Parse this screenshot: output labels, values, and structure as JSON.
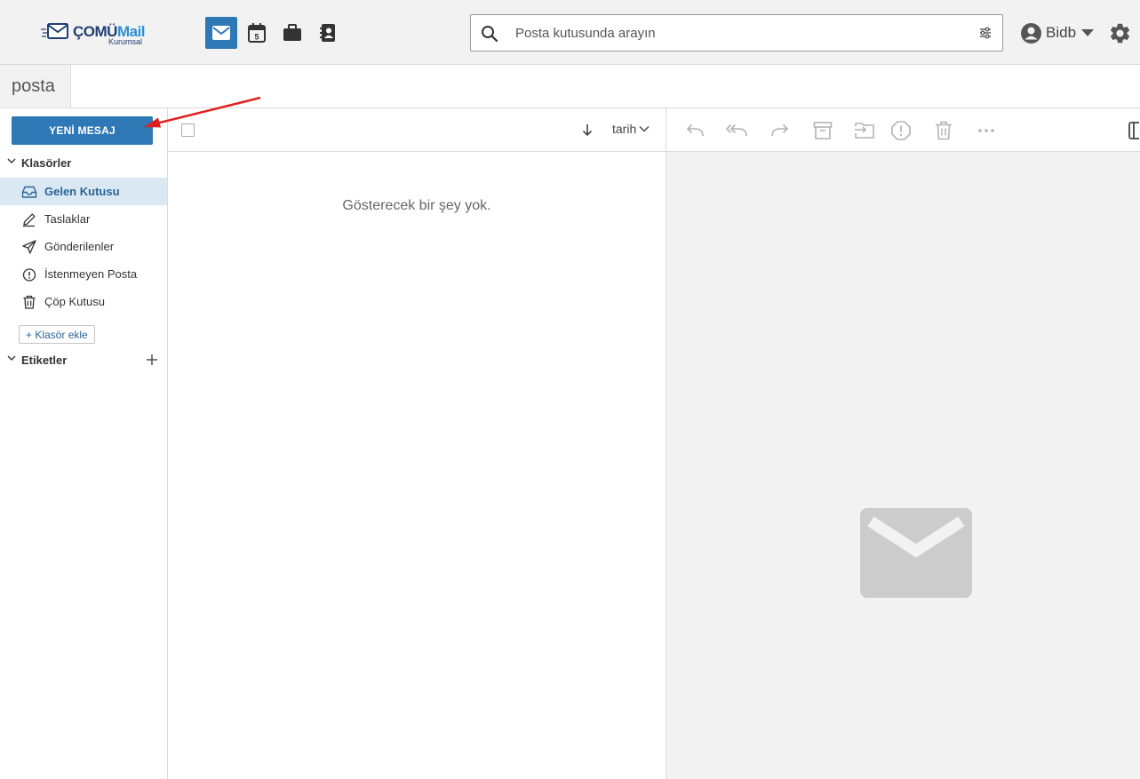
{
  "brand": {
    "name_part1": "ÇOMÜ",
    "name_part2": "Mail",
    "subtitle": "Kurumsal"
  },
  "apps": [
    {
      "name": "mail",
      "icon": "envelope-icon",
      "active": true
    },
    {
      "name": "calendar",
      "icon": "calendar-icon",
      "badge": "5"
    },
    {
      "name": "briefcase",
      "icon": "briefcase-icon"
    },
    {
      "name": "contacts",
      "icon": "address-book-icon"
    }
  ],
  "search": {
    "placeholder": "Posta kutusunda arayın"
  },
  "user": {
    "name": "Bidb"
  },
  "tab": {
    "label": "posta"
  },
  "sidebar": {
    "new_message": "YENİ MESAJ",
    "folders_header": "Klasörler",
    "folders": [
      {
        "label": "Gelen Kutusu",
        "icon": "inbox-icon",
        "active": true
      },
      {
        "label": "Taslaklar",
        "icon": "pencil-icon"
      },
      {
        "label": "Gönderilenler",
        "icon": "send-icon"
      },
      {
        "label": "İstenmeyen Posta",
        "icon": "spam-icon"
      },
      {
        "label": "Çöp Kutusu",
        "icon": "trash-icon"
      }
    ],
    "add_folder": "+ Klasör ekle",
    "labels_header": "Etiketler"
  },
  "list": {
    "sort_field": "tarih",
    "empty_text": "Gösterecek bir şey yok."
  },
  "colors": {
    "accent": "#2f78b6",
    "active_bg": "#d9e8f3",
    "preview_bg": "#f2f2f2",
    "annotation_arrow": "#e02020"
  }
}
